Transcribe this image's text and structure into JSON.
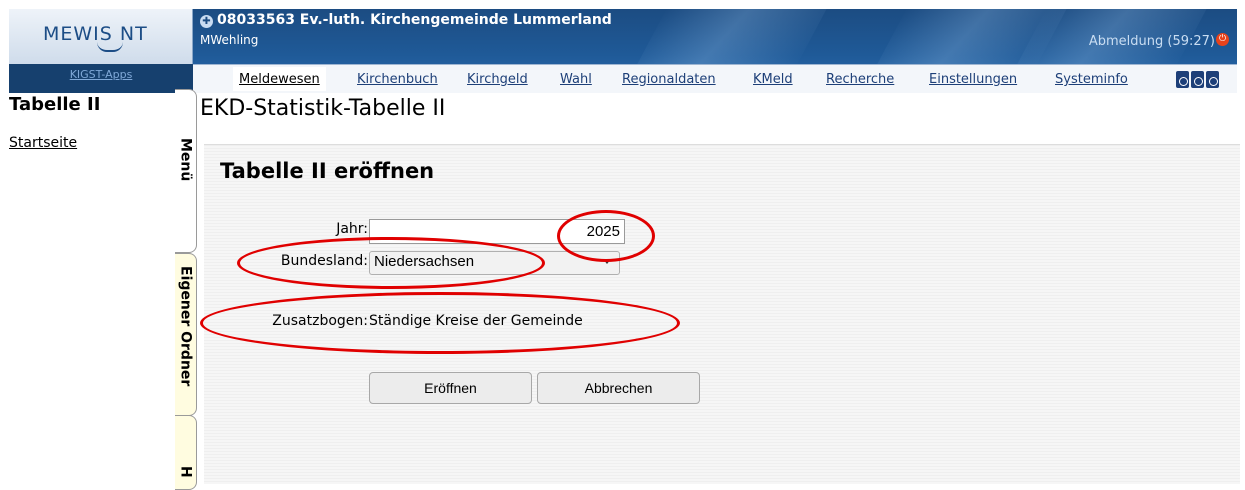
{
  "header": {
    "logo_text": "MEWIS NT",
    "apps_link": "KIGST-Apps",
    "parish_title": "08033563 Ev.-luth. Kirchengemeinde Lummerland",
    "user": "MWehling",
    "logout_label": "Abmeldung (59:27)",
    "colors": {
      "header_blue": "#1f5a98",
      "nav_text": "#1d3f78",
      "annotation_red": "#e00000"
    }
  },
  "nav": {
    "items": [
      {
        "label": "Meldewesen",
        "active": true
      },
      {
        "label": "Kirchenbuch",
        "active": false
      },
      {
        "label": "Kirchgeld",
        "active": false
      },
      {
        "label": "Wahl",
        "active": false
      },
      {
        "label": "Regionaldaten",
        "active": false
      },
      {
        "label": "KMeld",
        "active": false
      },
      {
        "label": "Recherche",
        "active": false
      },
      {
        "label": "Einstellungen",
        "active": false
      },
      {
        "label": "Systeminfo",
        "active": false
      }
    ],
    "extra_icon": "binoculars-icon"
  },
  "sidebar": {
    "title": "Tabelle II",
    "link": "Startseite",
    "tabs": [
      "Menü",
      "Eigener Ordner",
      "H"
    ]
  },
  "main": {
    "page_title": "EKD-Statistik-Tabelle II",
    "form_title": "Tabelle II eröffnen",
    "year_label": "Jahr:",
    "year_value": "2025",
    "state_label": "Bundesland:",
    "state_value": "Niedersachsen",
    "supplement_label": "Zusatzbogen:",
    "supplement_value": "Ständige Kreise der Gemeinde",
    "open_button": "Eröffnen",
    "cancel_button": "Abbrechen"
  }
}
